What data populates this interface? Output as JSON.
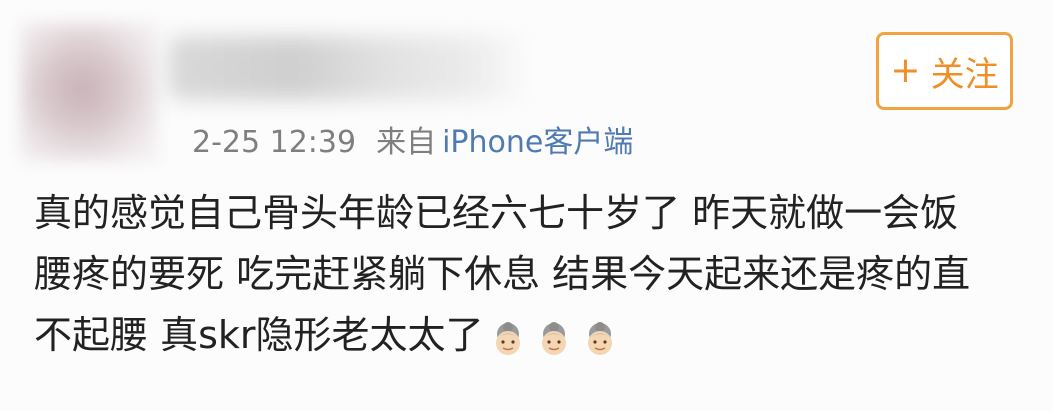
{
  "post": {
    "timestamp": "2-25 12:39",
    "source_prefix": "来自",
    "source_device": "iPhone客户端",
    "follow_label": "关注",
    "content_lines": [
      "真的感觉自己骨头年龄已经六七十岁了  昨天就做一会饭",
      "腰疼的要死  吃完赶紧躺下休息  结果今天起来还是疼的直",
      "不起腰  真skr隐形老太太了"
    ],
    "emojis": [
      "old-woman-icon",
      "old-woman-icon",
      "old-woman-icon"
    ]
  },
  "colors": {
    "follow_accent": "#ee8f27",
    "link_blue": "#4f7bb1",
    "meta_gray": "#7f7f7f"
  }
}
